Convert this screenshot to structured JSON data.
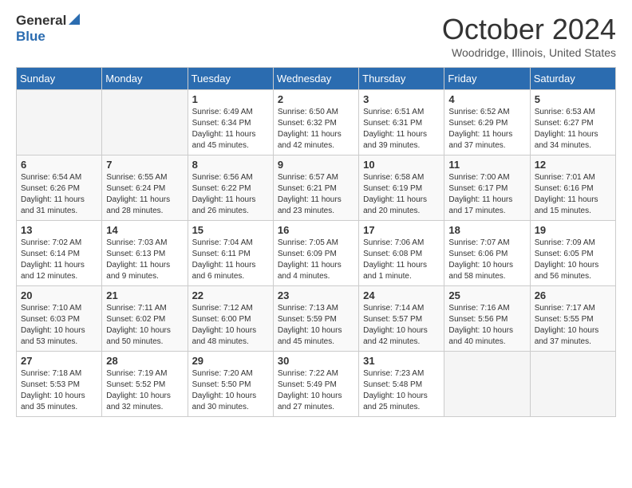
{
  "header": {
    "logo_general": "General",
    "logo_blue": "Blue",
    "title": "October 2024",
    "location": "Woodridge, Illinois, United States"
  },
  "calendar": {
    "weekdays": [
      "Sunday",
      "Monday",
      "Tuesday",
      "Wednesday",
      "Thursday",
      "Friday",
      "Saturday"
    ],
    "weeks": [
      [
        {
          "day": "",
          "info": ""
        },
        {
          "day": "",
          "info": ""
        },
        {
          "day": "1",
          "info": "Sunrise: 6:49 AM\nSunset: 6:34 PM\nDaylight: 11 hours and 45 minutes."
        },
        {
          "day": "2",
          "info": "Sunrise: 6:50 AM\nSunset: 6:32 PM\nDaylight: 11 hours and 42 minutes."
        },
        {
          "day": "3",
          "info": "Sunrise: 6:51 AM\nSunset: 6:31 PM\nDaylight: 11 hours and 39 minutes."
        },
        {
          "day": "4",
          "info": "Sunrise: 6:52 AM\nSunset: 6:29 PM\nDaylight: 11 hours and 37 minutes."
        },
        {
          "day": "5",
          "info": "Sunrise: 6:53 AM\nSunset: 6:27 PM\nDaylight: 11 hours and 34 minutes."
        }
      ],
      [
        {
          "day": "6",
          "info": "Sunrise: 6:54 AM\nSunset: 6:26 PM\nDaylight: 11 hours and 31 minutes."
        },
        {
          "day": "7",
          "info": "Sunrise: 6:55 AM\nSunset: 6:24 PM\nDaylight: 11 hours and 28 minutes."
        },
        {
          "day": "8",
          "info": "Sunrise: 6:56 AM\nSunset: 6:22 PM\nDaylight: 11 hours and 26 minutes."
        },
        {
          "day": "9",
          "info": "Sunrise: 6:57 AM\nSunset: 6:21 PM\nDaylight: 11 hours and 23 minutes."
        },
        {
          "day": "10",
          "info": "Sunrise: 6:58 AM\nSunset: 6:19 PM\nDaylight: 11 hours and 20 minutes."
        },
        {
          "day": "11",
          "info": "Sunrise: 7:00 AM\nSunset: 6:17 PM\nDaylight: 11 hours and 17 minutes."
        },
        {
          "day": "12",
          "info": "Sunrise: 7:01 AM\nSunset: 6:16 PM\nDaylight: 11 hours and 15 minutes."
        }
      ],
      [
        {
          "day": "13",
          "info": "Sunrise: 7:02 AM\nSunset: 6:14 PM\nDaylight: 11 hours and 12 minutes."
        },
        {
          "day": "14",
          "info": "Sunrise: 7:03 AM\nSunset: 6:13 PM\nDaylight: 11 hours and 9 minutes."
        },
        {
          "day": "15",
          "info": "Sunrise: 7:04 AM\nSunset: 6:11 PM\nDaylight: 11 hours and 6 minutes."
        },
        {
          "day": "16",
          "info": "Sunrise: 7:05 AM\nSunset: 6:09 PM\nDaylight: 11 hours and 4 minutes."
        },
        {
          "day": "17",
          "info": "Sunrise: 7:06 AM\nSunset: 6:08 PM\nDaylight: 11 hours and 1 minute."
        },
        {
          "day": "18",
          "info": "Sunrise: 7:07 AM\nSunset: 6:06 PM\nDaylight: 10 hours and 58 minutes."
        },
        {
          "day": "19",
          "info": "Sunrise: 7:09 AM\nSunset: 6:05 PM\nDaylight: 10 hours and 56 minutes."
        }
      ],
      [
        {
          "day": "20",
          "info": "Sunrise: 7:10 AM\nSunset: 6:03 PM\nDaylight: 10 hours and 53 minutes."
        },
        {
          "day": "21",
          "info": "Sunrise: 7:11 AM\nSunset: 6:02 PM\nDaylight: 10 hours and 50 minutes."
        },
        {
          "day": "22",
          "info": "Sunrise: 7:12 AM\nSunset: 6:00 PM\nDaylight: 10 hours and 48 minutes."
        },
        {
          "day": "23",
          "info": "Sunrise: 7:13 AM\nSunset: 5:59 PM\nDaylight: 10 hours and 45 minutes."
        },
        {
          "day": "24",
          "info": "Sunrise: 7:14 AM\nSunset: 5:57 PM\nDaylight: 10 hours and 42 minutes."
        },
        {
          "day": "25",
          "info": "Sunrise: 7:16 AM\nSunset: 5:56 PM\nDaylight: 10 hours and 40 minutes."
        },
        {
          "day": "26",
          "info": "Sunrise: 7:17 AM\nSunset: 5:55 PM\nDaylight: 10 hours and 37 minutes."
        }
      ],
      [
        {
          "day": "27",
          "info": "Sunrise: 7:18 AM\nSunset: 5:53 PM\nDaylight: 10 hours and 35 minutes."
        },
        {
          "day": "28",
          "info": "Sunrise: 7:19 AM\nSunset: 5:52 PM\nDaylight: 10 hours and 32 minutes."
        },
        {
          "day": "29",
          "info": "Sunrise: 7:20 AM\nSunset: 5:50 PM\nDaylight: 10 hours and 30 minutes."
        },
        {
          "day": "30",
          "info": "Sunrise: 7:22 AM\nSunset: 5:49 PM\nDaylight: 10 hours and 27 minutes."
        },
        {
          "day": "31",
          "info": "Sunrise: 7:23 AM\nSunset: 5:48 PM\nDaylight: 10 hours and 25 minutes."
        },
        {
          "day": "",
          "info": ""
        },
        {
          "day": "",
          "info": ""
        }
      ]
    ]
  }
}
